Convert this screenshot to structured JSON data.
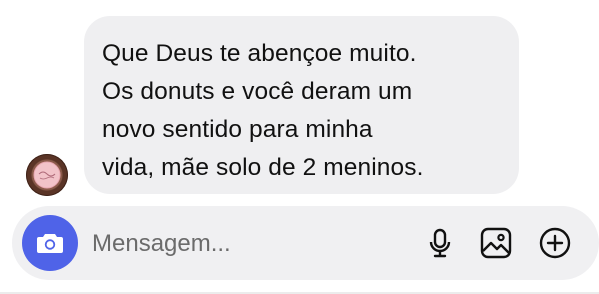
{
  "message": {
    "text": "Que Deus te abençoe muito.\nOs donuts e você deram um\nnovo sentido para minha\nvida, mãe solo de 2 meninos."
  },
  "composer": {
    "placeholder": "Mensagem...",
    "camera_icon": "camera-icon",
    "mic_icon": "microphone-icon",
    "gallery_icon": "image-icon",
    "plus_icon": "plus-circle-icon"
  },
  "colors": {
    "accent": "#4f63e8",
    "bubble_bg": "#efeff1",
    "composer_bg": "#f0f0f2"
  }
}
